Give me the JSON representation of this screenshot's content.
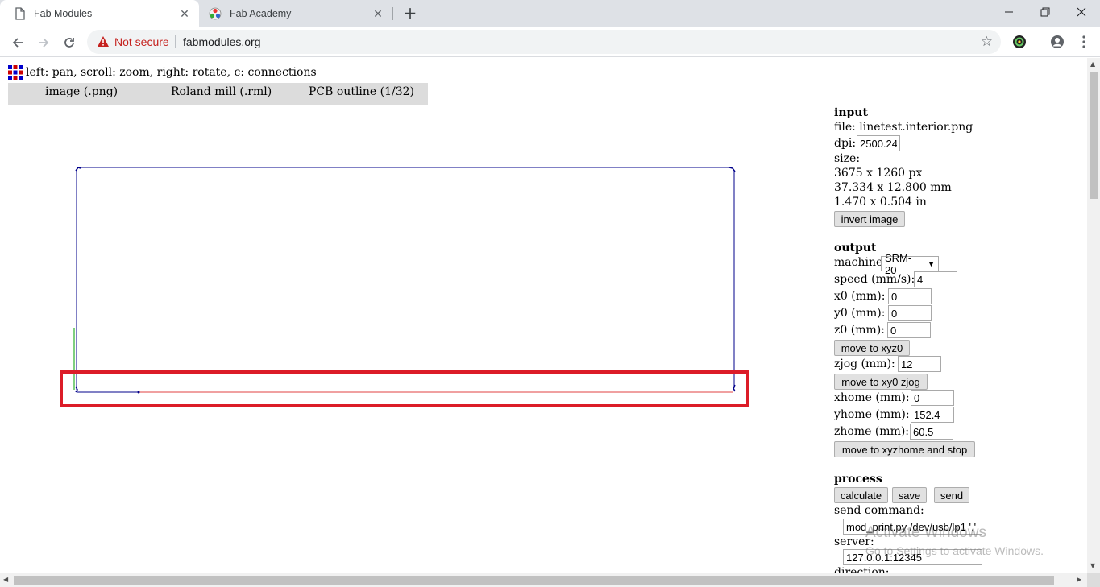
{
  "browser": {
    "tabs": [
      {
        "title": "Fab Modules",
        "active": true
      },
      {
        "title": "Fab Academy",
        "active": false
      }
    ],
    "security_label": "Not secure",
    "url": "fabmodules.org"
  },
  "page": {
    "hint": "left: pan, scroll: zoom, right: rotate, c: connections",
    "menu": [
      "image (.png)",
      "Roland mill (.rml)",
      "PCB outline (1/32)"
    ]
  },
  "input": {
    "header": "input",
    "file": "file: linetest.interior.png",
    "dpi_label": "dpi:",
    "dpi_value": "2500.24",
    "size_label": "size:",
    "size_px": "3675 x 1260 px",
    "size_mm": "37.334 x 12.800 mm",
    "size_in": "1.470 x 0.504 in",
    "invert_label": "invert image"
  },
  "output": {
    "header": "output",
    "machine_label": "machine",
    "machine_value": "SRM-20",
    "speed_label": "speed (mm/s):",
    "speed_value": "4",
    "x0_label": "x0 (mm):",
    "x0_value": "0",
    "y0_label": "y0 (mm):",
    "y0_value": "0",
    "z0_label": "z0 (mm):",
    "z0_value": "0",
    "move_xyz0_label": "move to xyz0",
    "zjog_label": "zjog (mm):",
    "zjog_value": "12",
    "move_xy0_label": "move to xy0 zjog",
    "xhome_label": "xhome (mm):",
    "xhome_value": "0",
    "yhome_label": "yhome (mm):",
    "yhome_value": "152.4",
    "zhome_label": "zhome (mm):",
    "zhome_value": "60.5",
    "move_home_label": "move to xyzhome and stop"
  },
  "process": {
    "header": "process",
    "calculate_label": "calculate",
    "save_label": "save",
    "send_label": "send",
    "command_label": "send command:",
    "command_value": "mod_print.py /dev/usb/lp1 '.'",
    "server_label": "server:",
    "server_value": "127.0.0.1:12345",
    "direction_label": "direction:"
  },
  "watermark": {
    "title": "Activate Windows",
    "subtitle": "Go to Settings to activate Windows."
  },
  "colors": {
    "toolpath": "#00008b",
    "highlight": "#dc1c28",
    "jog_green": "#00a000",
    "jog_red": "#e04040"
  }
}
